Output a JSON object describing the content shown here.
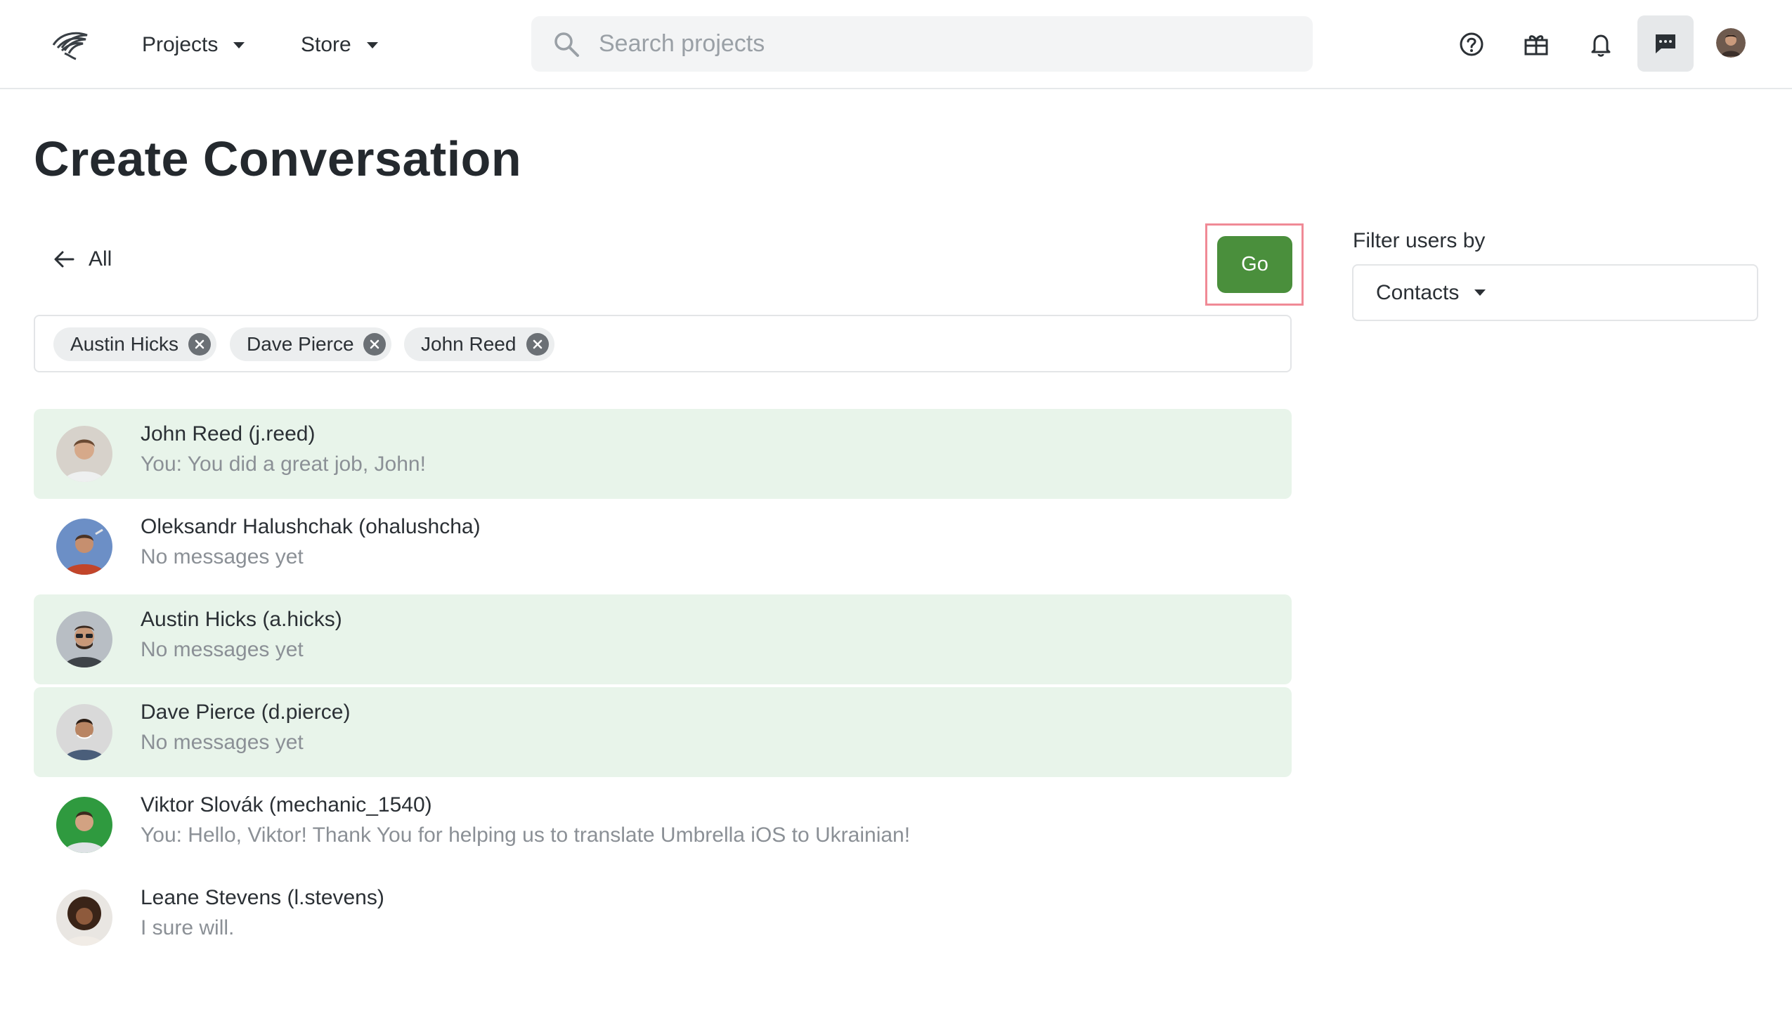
{
  "header": {
    "nav": [
      {
        "label": "Projects"
      },
      {
        "label": "Store"
      }
    ],
    "search_placeholder": "Search projects",
    "icons": [
      "help-circle-icon",
      "gift-icon",
      "bell-icon",
      "chat-icon"
    ]
  },
  "page": {
    "title": "Create Conversation",
    "back_label": "All",
    "go_label": "Go"
  },
  "selected_chips": [
    {
      "label": "Austin Hicks"
    },
    {
      "label": "Dave Pierce"
    },
    {
      "label": "John Reed"
    }
  ],
  "users": [
    {
      "name": "John Reed (j.reed)",
      "message": "You: You did a great job, John!",
      "selected": true
    },
    {
      "name": "Oleksandr Halushchak (ohalushcha)",
      "message": "No messages yet",
      "selected": false
    },
    {
      "name": "Austin Hicks (a.hicks)",
      "message": "No messages yet",
      "selected": true
    },
    {
      "name": "Dave Pierce (d.pierce)",
      "message": "No messages yet",
      "selected": true
    },
    {
      "name": "Viktor Slovák (mechanic_1540)",
      "message": "You: Hello, Viktor! Thank You for helping us to translate Umbrella iOS to Ukrainian!",
      "selected": false
    },
    {
      "name": "Leane Stevens (l.stevens)",
      "message": "I sure will.",
      "selected": false
    }
  ],
  "filter": {
    "label": "Filter users by",
    "selected": "Contacts"
  },
  "colors": {
    "accent": "#4a8f3c",
    "selected_row": "#e8f4ea",
    "highlight_border": "#f08a96"
  }
}
